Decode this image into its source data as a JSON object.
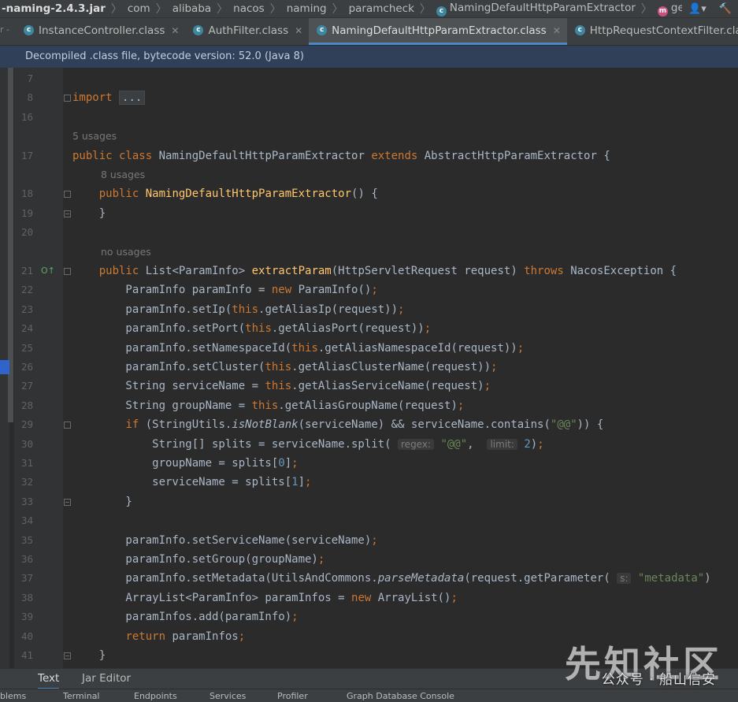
{
  "breadcrumb": {
    "items": [
      "-naming-2.4.3.jar",
      "com",
      "alibaba",
      "nacos",
      "naming",
      "paramcheck",
      "NamingDefaultHttpParamExtractor",
      "getAliasPort"
    ],
    "user_icon": "user-icon",
    "build_icon": "hammer-icon"
  },
  "left_strip_text": "r -",
  "tabs": [
    {
      "label": "InstanceController.class",
      "active": false
    },
    {
      "label": "AuthFilter.class",
      "active": false
    },
    {
      "label": "NamingDefaultHttpParamExtractor.class",
      "active": true
    },
    {
      "label": "HttpRequestContextFilter.class",
      "active": false
    }
  ],
  "banner": "Decompiled .class file, bytecode version: 52.0 (Java 8)",
  "code_lines": [
    {
      "n": "7"
    },
    {
      "n": "8"
    },
    {
      "n": "16"
    },
    {
      "n": ""
    },
    {
      "n": "17"
    },
    {
      "n": ""
    },
    {
      "n": "18"
    },
    {
      "n": "19"
    },
    {
      "n": "20"
    },
    {
      "n": ""
    },
    {
      "n": "21"
    },
    {
      "n": "22"
    },
    {
      "n": "23"
    },
    {
      "n": "24"
    },
    {
      "n": "25"
    },
    {
      "n": "26"
    },
    {
      "n": "27"
    },
    {
      "n": "28"
    },
    {
      "n": "29"
    },
    {
      "n": "30"
    },
    {
      "n": "31"
    },
    {
      "n": "32"
    },
    {
      "n": "33"
    },
    {
      "n": "34"
    },
    {
      "n": "35"
    },
    {
      "n": "36"
    },
    {
      "n": "37"
    },
    {
      "n": "38"
    },
    {
      "n": "39"
    },
    {
      "n": "40"
    },
    {
      "n": "41"
    }
  ],
  "hints": {
    "usages_5": "5 usages",
    "usages_8": "8 usages",
    "no_usages": "no usages",
    "regex": "regex:",
    "limit": "limit:",
    "s": "s:"
  },
  "bottom_tabs": [
    {
      "label": "Text",
      "active": true
    },
    {
      "label": "Jar Editor",
      "active": false
    }
  ],
  "status_items": [
    "blems",
    "Terminal",
    "Endpoints",
    "Services",
    "Profiler",
    "Graph Database Console"
  ],
  "watermark": {
    "logo": "先知社区",
    "caption": "公众号 · 船山信安"
  }
}
